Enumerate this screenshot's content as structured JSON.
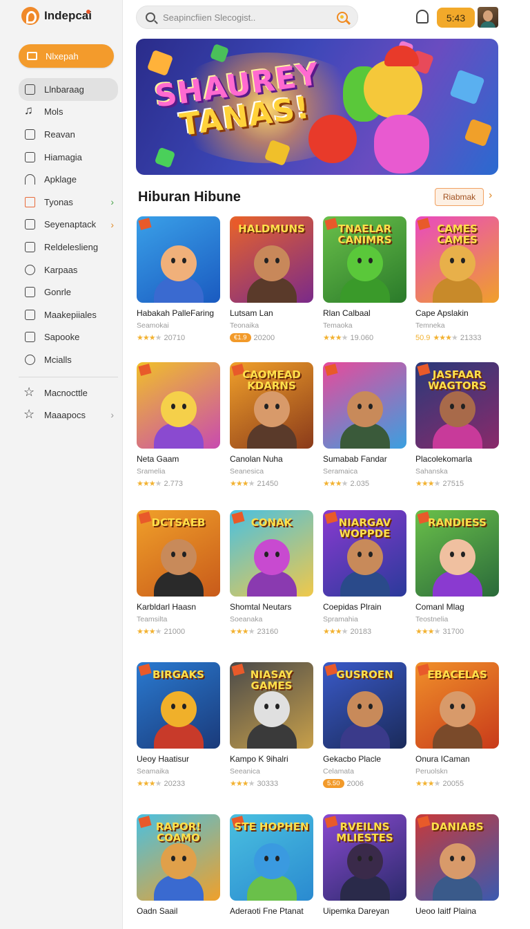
{
  "app": {
    "name": "Indepcai"
  },
  "sidebar": {
    "primary_button": "Nlxepah",
    "items": [
      {
        "label": "Llnbaraag",
        "icon": "book-icon",
        "active": true
      },
      {
        "label": "Mols",
        "icon": "music-icon"
      },
      {
        "label": "Reavan",
        "icon": "folder-icon"
      },
      {
        "label": "Hiamagia",
        "icon": "square-icon"
      },
      {
        "label": "Apklage",
        "icon": "arch-icon"
      },
      {
        "label": "Tyonas",
        "icon": "gift-icon",
        "chevron": "green"
      },
      {
        "label": "Seyenaptack",
        "icon": "cloud-icon",
        "chevron": "orange"
      },
      {
        "label": "Reldeleslieng",
        "icon": "badge-icon"
      },
      {
        "label": "Karpaas",
        "icon": "box-icon"
      },
      {
        "label": "Gonrle",
        "icon": "doc-icon"
      },
      {
        "label": "Maakepiiales",
        "icon": "grid-icon"
      },
      {
        "label": "Sapooke",
        "icon": "edit-icon"
      },
      {
        "label": "Mcialls",
        "icon": "clock-icon"
      }
    ],
    "secondary_items": [
      {
        "label": "Macnocttle",
        "icon": "star-icon"
      },
      {
        "label": "Maaapocs",
        "icon": "star-icon",
        "chevron": "gray"
      }
    ]
  },
  "header": {
    "search_placeholder": "Seapincfiien Slecogist..",
    "time": "5:43"
  },
  "banner": {
    "line1": "SHAUREY",
    "line2": "TANAS!"
  },
  "section": {
    "title": "Hiburan Hibune",
    "more_label": "Riabmak"
  },
  "games": [
    {
      "title": "Habakah PalleFaring",
      "sub": "Seamokai",
      "stars": 3,
      "count": "20710",
      "pill": "",
      "thumb_text": "",
      "colors": [
        "#3aa0e8",
        "#1a5ac0"
      ],
      "face": "#f0b07a",
      "body": "#3a6ad0"
    },
    {
      "title": "Lutsam Lan",
      "sub": "Teonaika",
      "stars": 0,
      "count": "20200",
      "pill": "€1.9",
      "thumb_text": "HALDMUNS",
      "colors": [
        "#e8642a",
        "#7a2a8a"
      ],
      "face": "#c8885a",
      "body": "#5a3a2a"
    },
    {
      "title": "Rlan Calbaal",
      "sub": "Temaoka",
      "stars": 3,
      "count": "19.060",
      "pill": "",
      "thumb_text": "TNAELAR CANIMRS",
      "colors": [
        "#6ac04a",
        "#2a7a2a"
      ],
      "face": "#5ac83a",
      "body": "#3a9a2a"
    },
    {
      "title": "Cape Apslakin",
      "sub": "Temneka",
      "stars": 2,
      "count": "21333",
      "pill": "",
      "rating_prefix": "50.9",
      "thumb_text": "CAMES CAMES",
      "colors": [
        "#e84ac0",
        "#f0a02a"
      ],
      "face": "#e8b04a",
      "body": "#c88a2a"
    },
    {
      "title": "Neta Gaam",
      "sub": "Sramelia",
      "stars": 3,
      "count": "2.773",
      "pill": "",
      "thumb_text": "",
      "colors": [
        "#f0c02a",
        "#c84ab0"
      ],
      "face": "#f5d04a",
      "body": "#8a4ad0"
    },
    {
      "title": "Canolan Nuha",
      "sub": "Seanesica",
      "stars": 3,
      "count": "21450",
      "pill": "",
      "thumb_text": "CAOMEAD KDARNS",
      "colors": [
        "#f0a02a",
        "#8a3a1a"
      ],
      "face": "#d89a6a",
      "body": "#5a3a2a"
    },
    {
      "title": "Sumabab Fandar",
      "sub": "Seramaica",
      "stars": 3,
      "count": "2.035",
      "pill": "",
      "thumb_text": "",
      "colors": [
        "#e84a9a",
        "#3aa0e0"
      ],
      "face": "#c88a5a",
      "body": "#3a5a3a"
    },
    {
      "title": "Placolekomarla",
      "sub": "Sahanska",
      "stars": 3,
      "count": "27515",
      "pill": "",
      "thumb_text": "JASFAAR WAGTORS",
      "colors": [
        "#2a3a7a",
        "#8a2a6a"
      ],
      "face": "#a86a4a",
      "body": "#c83a9a"
    },
    {
      "title": "Karbldarl Haasn",
      "sub": "Teamsilta",
      "stars": 3,
      "count": "21000",
      "pill": "",
      "thumb_text": "DCTSAEB",
      "colors": [
        "#f0a02a",
        "#c85a1a"
      ],
      "face": "#c88a5a",
      "body": "#2a2a2a"
    },
    {
      "title": "Shomtal Neutars",
      "sub": "Soeanaka",
      "stars": 3,
      "count": "23160",
      "pill": "",
      "thumb_text": "CONAK",
      "colors": [
        "#4ac0e0",
        "#f0c84a"
      ],
      "face": "#c84ad0",
      "body": "#8a3ab0"
    },
    {
      "title": "Coepidas Plrain",
      "sub": "Spramahia",
      "stars": 3,
      "count": "20183",
      "pill": "",
      "thumb_text": "NIARGAV WOPPDE",
      "colors": [
        "#8a3ad0",
        "#2a3a9a"
      ],
      "face": "#c88a5a",
      "body": "#2a4a8a"
    },
    {
      "title": "Comanl Mlag",
      "sub": "Teostnelia",
      "stars": 3,
      "count": "31700",
      "pill": "",
      "thumb_text": "RANDIESS",
      "colors": [
        "#6ac04a",
        "#2a6a3a"
      ],
      "face": "#f0c0a0",
      "body": "#8a3ad0"
    },
    {
      "title": "Ueoy Haatisur",
      "sub": "Seamaika",
      "stars": 3,
      "count": "20233",
      "pill": "",
      "thumb_text": "BIRGAKS",
      "colors": [
        "#2a7ad0",
        "#1a3a7a"
      ],
      "face": "#f0b02a",
      "body": "#c83a2a"
    },
    {
      "title": "Kampo K 9ihalri",
      "sub": "Seeanica",
      "stars": 3,
      "count": "30333",
      "pill": "",
      "thumb_text": "NIASAY GAMES",
      "colors": [
        "#4a4a4a",
        "#c8a04a"
      ],
      "face": "#e0e0e0",
      "body": "#3a3a3a"
    },
    {
      "title": "Gekacbo Placle",
      "sub": "Celamata",
      "stars": 0,
      "count": "2006",
      "pill": "5.50",
      "thumb_text": "GUSROEN",
      "colors": [
        "#3a5ac8",
        "#1a2a5a"
      ],
      "face": "#c88a5a",
      "body": "#3a3a8a"
    },
    {
      "title": "Onura ICaman",
      "sub": "Peruolskn",
      "stars": 3,
      "count": "20055",
      "pill": "",
      "thumb_text": "EBACELAS",
      "colors": [
        "#f0902a",
        "#c83a1a"
      ],
      "face": "#d89a6a",
      "body": "#7a4a2a"
    },
    {
      "title": "Oadn Saail",
      "sub": "",
      "stars": 0,
      "count": "",
      "pill": "",
      "thumb_text": "RAPOR! COAMO",
      "colors": [
        "#4ac0e0",
        "#f0a02a"
      ],
      "face": "#e0a04a",
      "body": "#3a6ad0"
    },
    {
      "title": "Aderaoti Fne Ptanat",
      "sub": "",
      "stars": 0,
      "count": "",
      "pill": "",
      "thumb_text": "STE HOPHEN",
      "colors": [
        "#4ac0e0",
        "#2a8ad0"
      ],
      "face": "#3a9ae0",
      "body": "#6ac04a"
    },
    {
      "title": "Uipemka Dareyan",
      "sub": "",
      "stars": 0,
      "count": "",
      "pill": "",
      "thumb_text": "RVEILNS MLIESTES",
      "colors": [
        "#8a4ad0",
        "#2a2a6a"
      ],
      "face": "#3a2a4a",
      "body": "#2a2a4a"
    },
    {
      "title": "Ueoo Iaitf Plaina",
      "sub": "",
      "stars": 0,
      "count": "",
      "pill": "",
      "thumb_text": "DANIABS",
      "colors": [
        "#c83a3a",
        "#3a5ab0"
      ],
      "face": "#d89a6a",
      "body": "#3a5a8a"
    }
  ]
}
